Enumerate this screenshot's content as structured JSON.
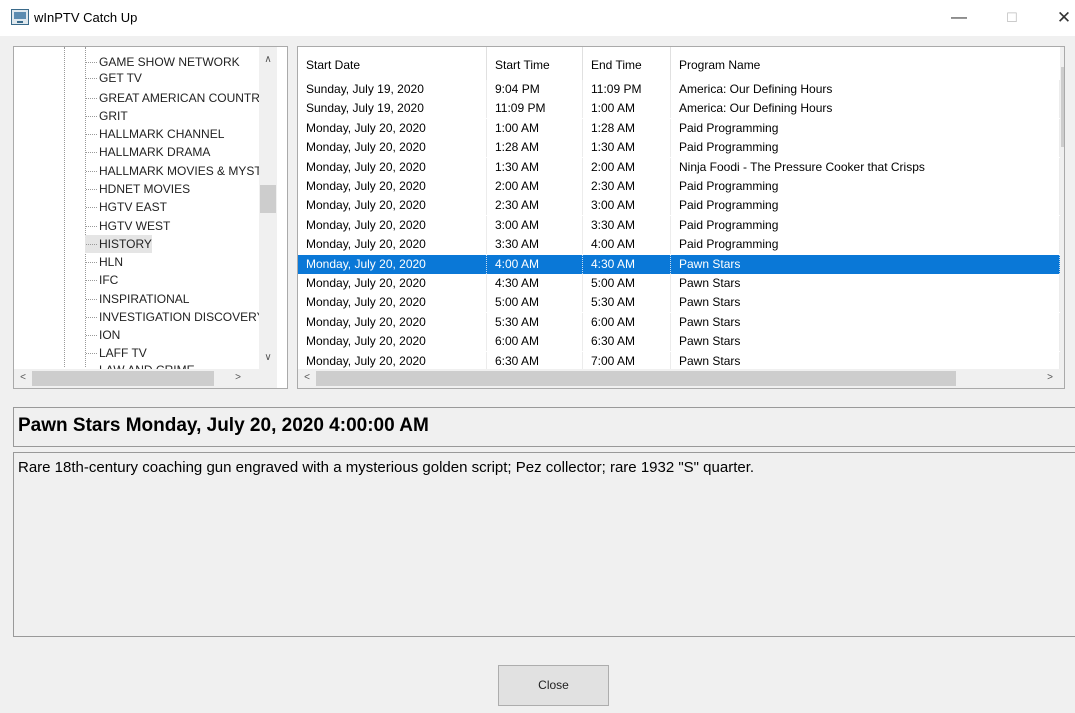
{
  "window": {
    "title": "wInPTV Catch Up",
    "minimize": "—",
    "maximize": "☐",
    "close": "✕"
  },
  "channels": {
    "items": [
      "GAME SHOW NETWORK",
      "GET TV",
      "GREAT AMERICAN COUNTRY",
      "GRIT",
      "HALLMARK CHANNEL",
      "HALLMARK DRAMA",
      "HALLMARK MOVIES & MYSTE",
      "HDNET MOVIES",
      "HGTV EAST",
      "HGTV WEST",
      "HISTORY",
      "HLN",
      "IFC",
      "INSPIRATIONAL",
      "INVESTIGATION DISCOVERY",
      "ION",
      "LAFF TV",
      "LAW AND CRIME"
    ],
    "selected": "HISTORY"
  },
  "schedule": {
    "columns": [
      "Start Date",
      "Start Time",
      "End Time",
      "Program Name"
    ],
    "rows": [
      [
        "Sunday, July 19, 2020",
        "9:04 PM",
        "11:09 PM",
        "America: Our Defining Hours"
      ],
      [
        "Sunday, July 19, 2020",
        "11:09 PM",
        "1:00 AM",
        "America: Our Defining Hours"
      ],
      [
        "Monday, July 20, 2020",
        "1:00 AM",
        "1:28 AM",
        "Paid Programming"
      ],
      [
        "Monday, July 20, 2020",
        "1:28 AM",
        "1:30 AM",
        "Paid Programming"
      ],
      [
        "Monday, July 20, 2020",
        "1:30 AM",
        "2:00 AM",
        "Ninja Foodi - The Pressure Cooker that Crisps"
      ],
      [
        "Monday, July 20, 2020",
        "2:00 AM",
        "2:30 AM",
        "Paid Programming"
      ],
      [
        "Monday, July 20, 2020",
        "2:30 AM",
        "3:00 AM",
        "Paid Programming"
      ],
      [
        "Monday, July 20, 2020",
        "3:00 AM",
        "3:30 AM",
        "Paid Programming"
      ],
      [
        "Monday, July 20, 2020",
        "3:30 AM",
        "4:00 AM",
        "Paid Programming"
      ],
      [
        "Monday, July 20, 2020",
        "4:00 AM",
        "4:30 AM",
        "Pawn Stars"
      ],
      [
        "Monday, July 20, 2020",
        "4:30 AM",
        "5:00 AM",
        "Pawn Stars"
      ],
      [
        "Monday, July 20, 2020",
        "5:00 AM",
        "5:30 AM",
        "Pawn Stars"
      ],
      [
        "Monday, July 20, 2020",
        "5:30 AM",
        "6:00 AM",
        "Pawn Stars"
      ],
      [
        "Monday, July 20, 2020",
        "6:00 AM",
        "6:30 AM",
        "Pawn Stars"
      ],
      [
        "Monday, July 20, 2020",
        "6:30 AM",
        "7:00 AM",
        "Pawn Stars"
      ]
    ],
    "selected_index": 9
  },
  "details": {
    "title": "Pawn Stars  Monday, July 20, 2020 4:00:00 AM",
    "description": "Rare 18th-century coaching gun engraved with a mysterious golden script; Pez collector; rare 1932 \"S\" quarter."
  },
  "footer": {
    "close_label": "Close"
  },
  "scroll_arrows": {
    "up": "∧",
    "down": "∨",
    "left": "<",
    "right": ">"
  }
}
